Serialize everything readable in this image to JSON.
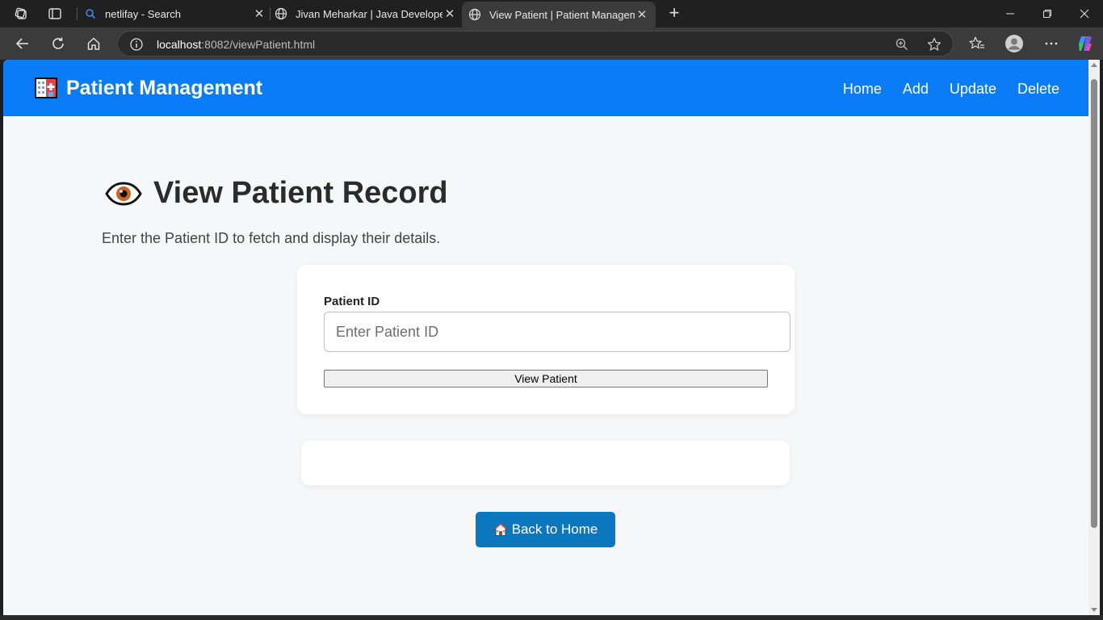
{
  "browser": {
    "tabs": [
      {
        "title": "netlifay - Search",
        "favicon": "search-icon",
        "active": false
      },
      {
        "title": "Jivan Meharkar | Java Developer",
        "favicon": "globe-icon",
        "active": false
      },
      {
        "title": "View Patient | Patient Management",
        "favicon": "globe-icon",
        "active": true
      }
    ],
    "url_host": "localhost",
    "url_rest": ":8082/viewPatient.html"
  },
  "navbar": {
    "brand": "Patient Management",
    "links": [
      "Home",
      "Add",
      "Update",
      "Delete"
    ]
  },
  "main": {
    "title": "View Patient Record",
    "subtitle": "Enter the Patient ID to fetch and display their details.",
    "form": {
      "label": "Patient ID",
      "placeholder": "Enter Patient ID",
      "button": "View Patient"
    },
    "back_button": "Back to Home"
  },
  "colors": {
    "navbar": "#0a7cf7",
    "back_button": "#0a77bf",
    "page_bg": "#f6f7f9"
  }
}
